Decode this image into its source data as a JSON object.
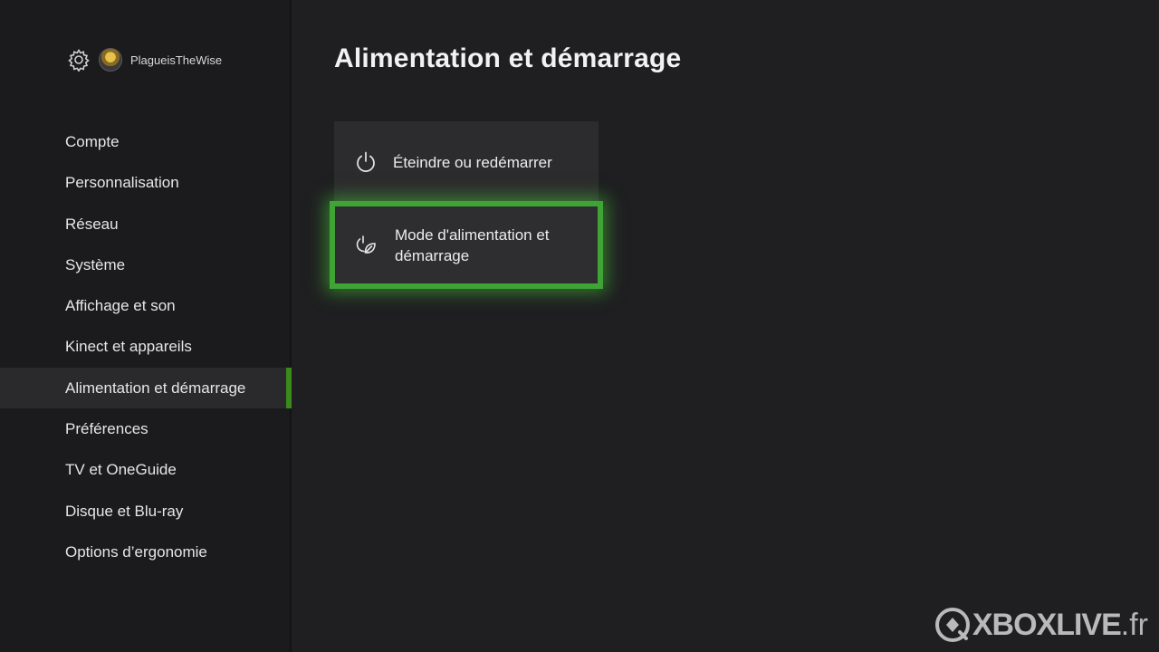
{
  "header": {
    "gamertag": "PlagueisTheWise"
  },
  "sidebar": {
    "items": [
      {
        "label": "Compte"
      },
      {
        "label": "Personnalisation"
      },
      {
        "label": "Réseau"
      },
      {
        "label": "Système"
      },
      {
        "label": "Affichage et son"
      },
      {
        "label": "Kinect et appareils"
      },
      {
        "label": "Alimentation et démarrage",
        "selected": true
      },
      {
        "label": "Préférences"
      },
      {
        "label": "TV et OneGuide"
      },
      {
        "label": "Disque et Blu-ray"
      },
      {
        "label": "Options d’ergonomie"
      }
    ]
  },
  "main": {
    "title": "Alimentation et démarrage",
    "tiles": [
      {
        "label": "Éteindre ou redémarrer",
        "icon": "power-icon"
      },
      {
        "label": "Mode d'alimentation et démarrage",
        "icon": "power-mode-leaf-icon",
        "focused": true
      }
    ]
  },
  "watermark": {
    "brand": "XBOXLIVE",
    "tld": ".fr"
  },
  "colors": {
    "accent": "#3fa336",
    "selection_bar": "#3a8a1e",
    "background": "#1f1f21",
    "tile": "#2c2c2e"
  }
}
